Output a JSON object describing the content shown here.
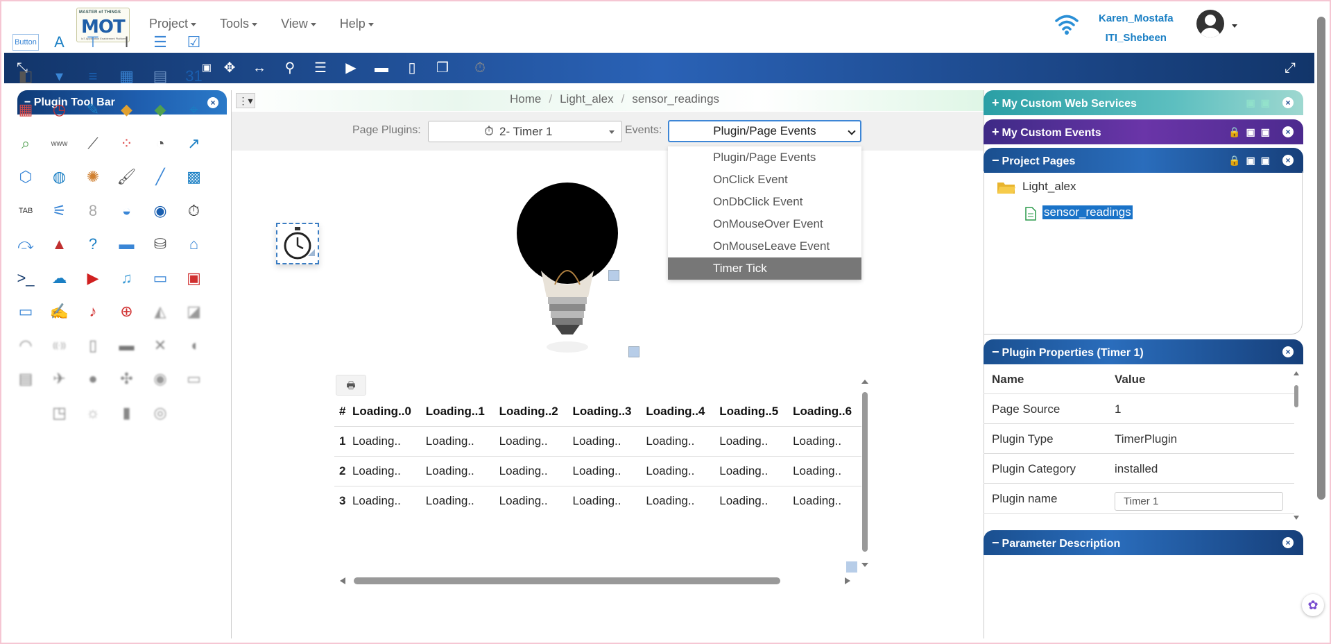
{
  "topnav": {
    "logo_line1": "MASTER of THINGS",
    "logo_main": "MOT",
    "logo_tag": "IoT Application Enablement Platform",
    "menus": [
      "Project",
      "Tools",
      "View",
      "Help"
    ],
    "user_name": "Karen_Mostafa",
    "user_org": "ITI_Shebeen"
  },
  "left_panel": {
    "title": "Plugin Tool Bar",
    "close": "×",
    "button_label": "Button"
  },
  "breadcrumb": [
    "Home",
    "Light_alex",
    "sensor_readings"
  ],
  "controls": {
    "page_plugins_label": "Page Plugins:",
    "page_plugins_value": "2- Timer 1",
    "events_label": "Events:",
    "events_value": "Plugin/Page Events"
  },
  "events_options": [
    "Plugin/Page Events",
    "OnClick Event",
    "OnDbClick Event",
    "OnMouseOver Event",
    "OnMouseLeave Event",
    "Timer Tick"
  ],
  "table": {
    "headers": [
      "#",
      "Loading..0",
      "Loading..1",
      "Loading..2",
      "Loading..3",
      "Loading..4",
      "Loading..5",
      "Loading..6"
    ],
    "rows": [
      [
        "1",
        "Loading..",
        "Loading..",
        "Loading..",
        "Loading..",
        "Loading..",
        "Loading..",
        "Loading.."
      ],
      [
        "2",
        "Loading..",
        "Loading..",
        "Loading..",
        "Loading..",
        "Loading..",
        "Loading..",
        "Loading.."
      ],
      [
        "3",
        "Loading..",
        "Loading..",
        "Loading..",
        "Loading..",
        "Loading..",
        "Loading..",
        "Loading.."
      ]
    ]
  },
  "right_panel": {
    "services_title": "My Custom Web Services",
    "events_title": "My Custom Events",
    "pages_title": "Project Pages",
    "project_name": "Light_alex",
    "page_name": "sensor_readings",
    "props_title": "Plugin Properties (Timer 1)",
    "props_headers": [
      "Name",
      "Value"
    ],
    "props_rows": [
      [
        "Page Source",
        "1"
      ],
      [
        "Plugin Type",
        "TimerPlugin"
      ],
      [
        "Plugin Category",
        "installed"
      ],
      [
        "Plugin name",
        ""
      ]
    ],
    "plugin_name_value": "Timer 1",
    "param_title": "Parameter Description"
  },
  "colors": {
    "toolbar": "#1f4f92",
    "accent": "#1a7fc4",
    "teal": "#3aa6a8",
    "purple": "#5b2b8c",
    "selected": "#777777"
  }
}
